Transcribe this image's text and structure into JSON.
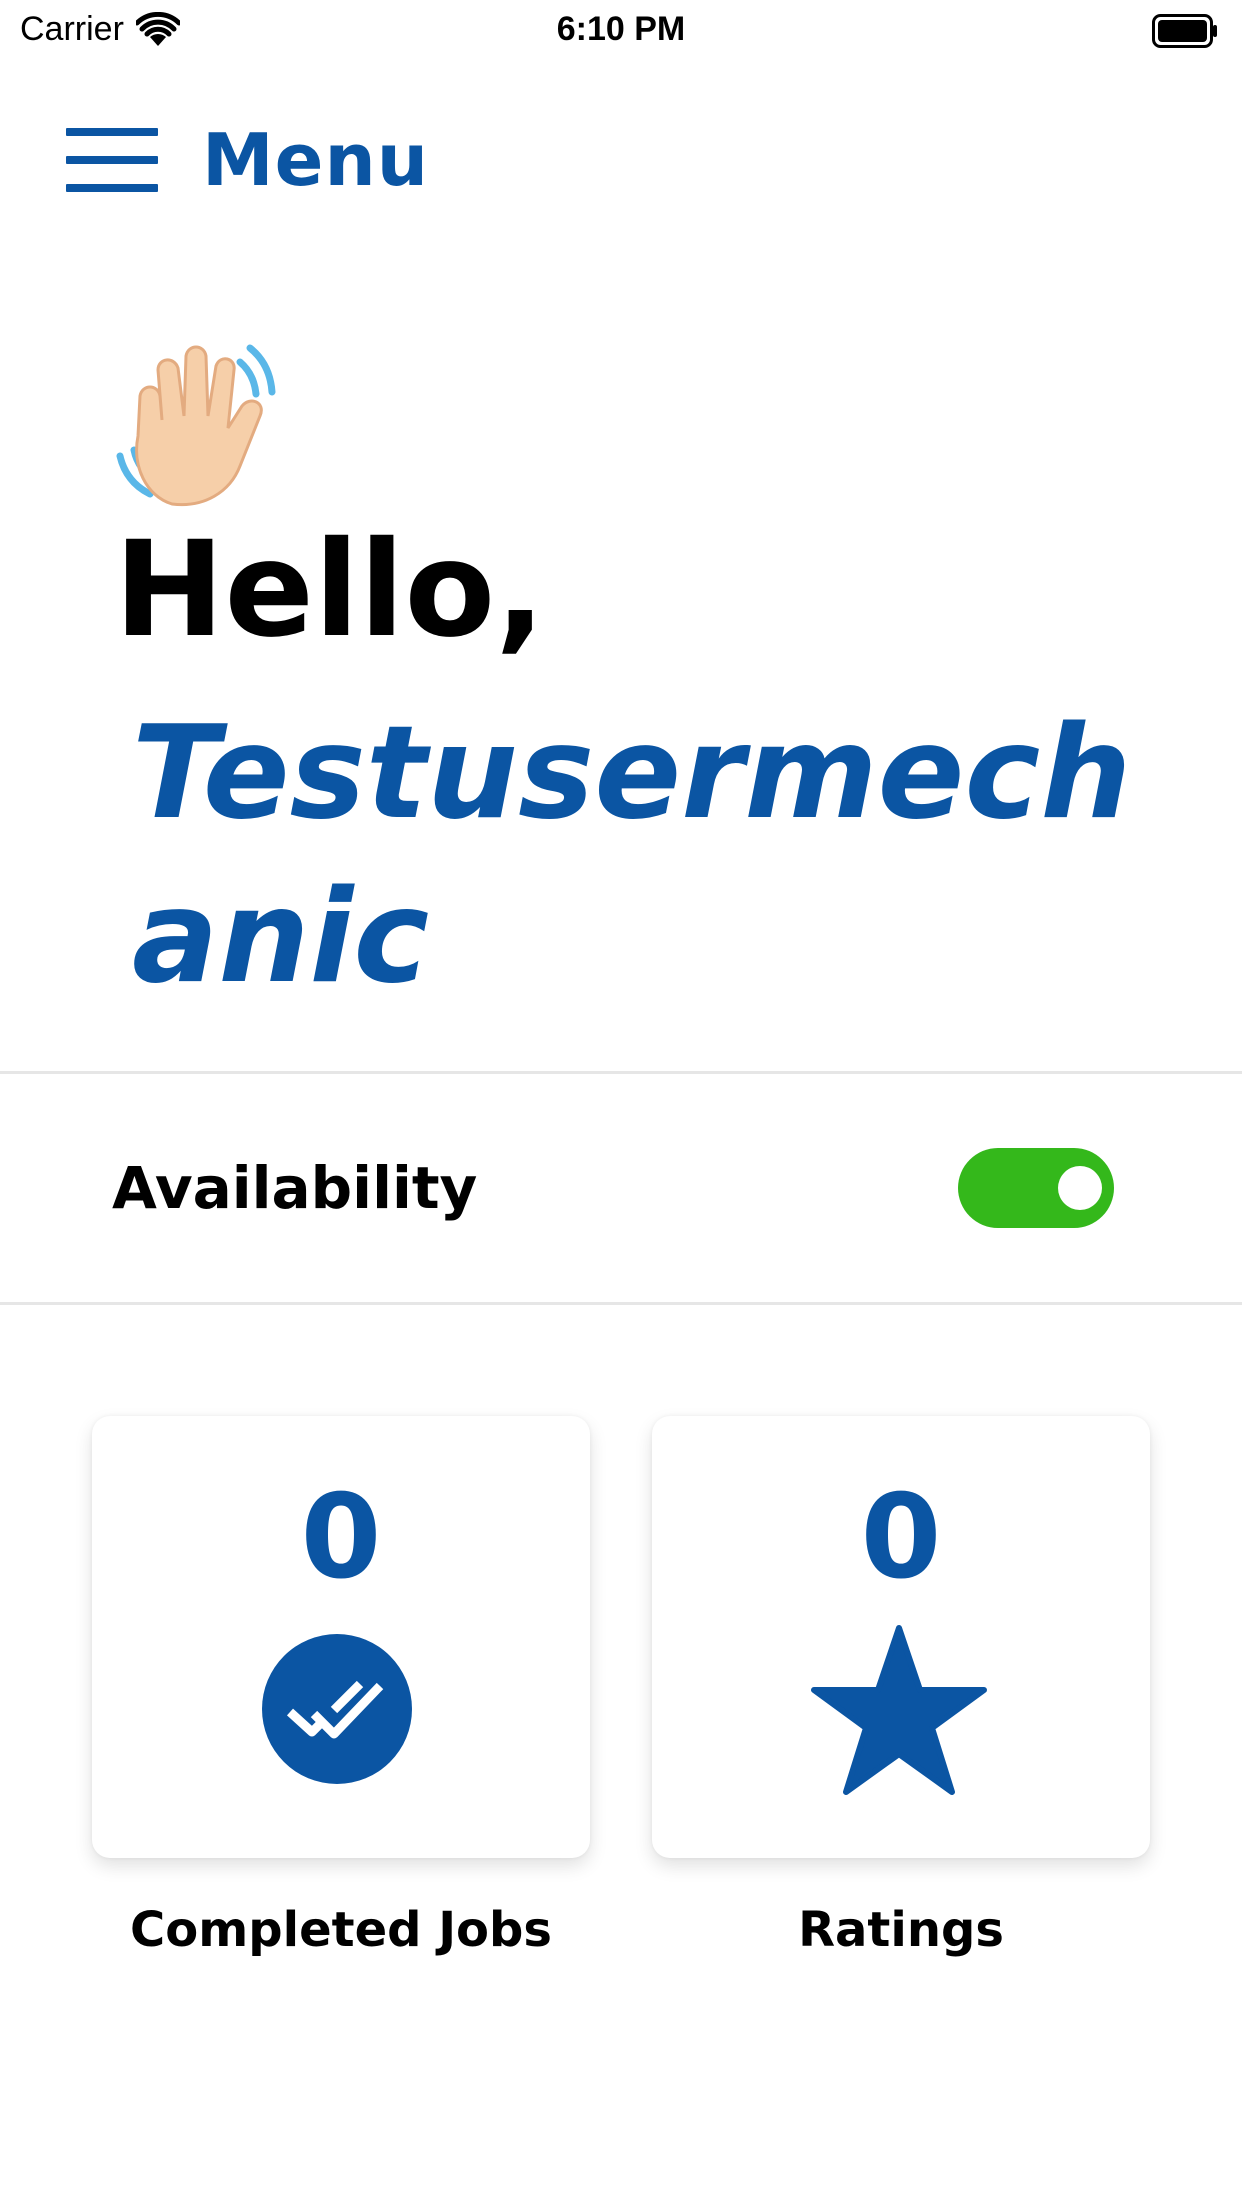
{
  "status_bar": {
    "carrier": "Carrier",
    "time": "6:10 PM",
    "icons": [
      "wifi-icon",
      "battery-icon"
    ]
  },
  "header": {
    "menu_label": "Menu",
    "menu_icon": "hamburger-icon"
  },
  "greeting": {
    "icon": "waving-hand-icon",
    "hello": "Hello,",
    "user_name": "Testusermechanic"
  },
  "availability": {
    "label": "Availability",
    "toggle_on": true
  },
  "stats": {
    "completed_jobs": {
      "value": "0",
      "label": "Completed Jobs",
      "icon": "double-check-circle-icon"
    },
    "ratings": {
      "value": "0",
      "label": "Ratings",
      "icon": "star-icon"
    }
  },
  "colors": {
    "brand_blue": "#0b55a3",
    "toggle_green": "#34b81b",
    "divider": "#e6e6e6"
  }
}
